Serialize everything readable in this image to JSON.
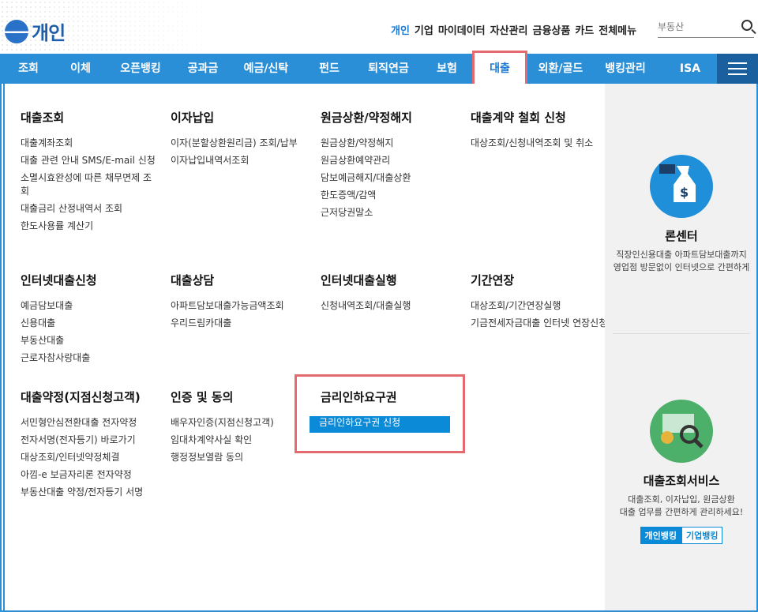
{
  "header": {
    "logo_text": "개인",
    "util_menu": [
      "개인",
      "기업",
      "마이데이터",
      "자산관리",
      "금융상품",
      "카드",
      "전체메뉴"
    ],
    "search_placeholder": "부동산"
  },
  "gnb": {
    "items": [
      "조회",
      "이체",
      "오픈뱅킹",
      "공과금",
      "예금/신탁",
      "펀드",
      "퇴직연금",
      "보험",
      "대출",
      "외환/골드",
      "뱅킹관리",
      "ISA"
    ],
    "active": "대출"
  },
  "groups": [
    {
      "title": "대출조회",
      "items": [
        "대출계좌조회",
        "대출 관련 안내 SMS/E-mail 신청",
        "소멸시효완성에 따른 채무면제 조회",
        "대출금리 산정내역서 조회",
        "한도사용률 계산기"
      ]
    },
    {
      "title": "이자납입",
      "items": [
        "이자(분할상환원리금) 조회/납부",
        "이자납입내역서조회"
      ]
    },
    {
      "title": "원금상환/약정해지",
      "items": [
        "원금상환/약정해지",
        "원금상환예약관리",
        "담보예금해지/대출상환",
        "한도증액/감액",
        "근저당권말소"
      ]
    },
    {
      "title": "대출계약 철회 신청",
      "items": [
        "대상조회/신청내역조회 및 취소"
      ]
    },
    {
      "title": "인터넷대출신청",
      "items": [
        "예금담보대출",
        "신용대출",
        "부동산대출",
        "근로자참사랑대출"
      ]
    },
    {
      "title": "대출상담",
      "items": [
        "아파트담보대출가능금액조회",
        "우리드림카대출"
      ]
    },
    {
      "title": "인터넷대출실행",
      "items": [
        "신청내역조회/대출실행"
      ]
    },
    {
      "title": "기간연장",
      "items": [
        "대상조회/기간연장실행",
        "기금전세자금대출 인터넷 연장신청"
      ]
    },
    {
      "title": "대출약정(지점신청고객)",
      "items": [
        "서민형안심전환대출 전자약정",
        "전자서명(전자등기) 바로가기",
        "대상조회/인터넷약정체결",
        "아낌-e 보금자리론 전자약정",
        "부동산대출 약정/전자등기 서명"
      ]
    },
    {
      "title": "인증 및 동의",
      "items": [
        "배우자인증(지점신청고객)",
        "임대차계약사실 확인",
        "행정정보열람 동의"
      ]
    },
    {
      "title": "금리인하요구권",
      "items": [
        "금리인하요구권 신청"
      ]
    }
  ],
  "aside": {
    "loan_center": {
      "title": "론센터",
      "desc1": "직장인신용대출 아파트담보대출까지",
      "desc2": "영업점 방문없이 인터넷으로 간편하게"
    },
    "loan_service": {
      "title": "대출조회서비스",
      "desc1": "대출조회, 이자납입, 원금상환",
      "desc2": "대출 업무를 간편하게 관리하세요!",
      "btn_personal": "개인뱅킹",
      "btn_corp": "기업뱅킹"
    }
  }
}
